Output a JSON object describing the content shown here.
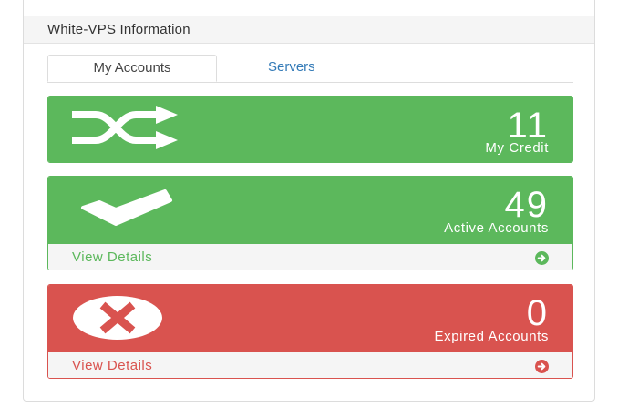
{
  "panel": {
    "title": "White-VPS Information"
  },
  "tabs": [
    {
      "label": "My Accounts",
      "active": true
    },
    {
      "label": "Servers",
      "active": false
    }
  ],
  "cards": {
    "credit": {
      "value": "11",
      "label": "My Credit",
      "icon": "shuffle-icon",
      "color": "#5cb85c"
    },
    "active": {
      "value": "49",
      "label": "Active Accounts",
      "icon": "checkmark-icon",
      "link": "View Details",
      "color": "#5cb85c"
    },
    "expired": {
      "value": "0",
      "label": "Expired Accounts",
      "icon": "x-circle-icon",
      "link": "View Details",
      "color": "#d9534f"
    }
  }
}
